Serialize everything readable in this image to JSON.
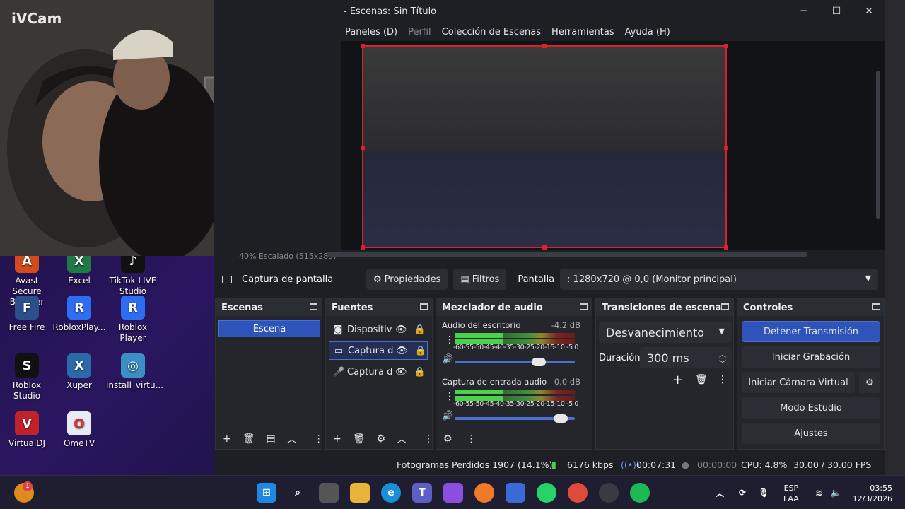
{
  "desktop": {
    "icons": [
      {
        "label": "Avast Secure Browser",
        "glyph": "A",
        "color": "#d44a1b"
      },
      {
        "label": "Excel",
        "glyph": "X",
        "color": "#1f7a45"
      },
      {
        "label": "TikTok LIVE Studio",
        "glyph": "♪",
        "color": "#111"
      },
      {
        "label": "Free Fire",
        "glyph": "F",
        "color": "#2a4f8a"
      },
      {
        "label": "RobloxPlay...",
        "glyph": "R",
        "color": "#2d6df2"
      },
      {
        "label": "Roblox Player",
        "glyph": "R",
        "color": "#2d6df2"
      },
      {
        "label": "Roblox Studio",
        "glyph": "S",
        "color": "#111"
      },
      {
        "label": "Xuper",
        "glyph": "X",
        "color": "#2a6aa8"
      },
      {
        "label": "install_virtu...",
        "glyph": "◎",
        "color": "#3a8fc4"
      },
      {
        "label": "VirtualDJ",
        "glyph": "V",
        "color": "#c0242a"
      },
      {
        "label": "OmeTV",
        "glyph": "O",
        "color": "#e7ecf2"
      }
    ]
  },
  "cam": {
    "brand": "iVCam"
  },
  "obs": {
    "title": "- Escenas: Sin Título",
    "menu": [
      "Paneles (D)",
      "Perfil",
      "Colección de Escenas",
      "Herramientas",
      "Ayuda (H)"
    ],
    "preview_status": "40%   Escalado (515x289)",
    "source_toolbar": {
      "source_name": "Captura de pantalla",
      "properties": "Propiedades",
      "filters": "Filtros",
      "display_label": "Pantalla",
      "display_value": ": 1280x720 @ 0,0 (Monitor principal)"
    },
    "scenes": {
      "title": "Escenas",
      "items": [
        "Escena"
      ]
    },
    "sources": {
      "title": "Fuentes",
      "items": [
        {
          "label": "Dispositiv",
          "icon": "camera-icon"
        },
        {
          "label": "Captura d",
          "icon": "monitor-icon"
        },
        {
          "label": "Captura d",
          "icon": "microphone-icon"
        }
      ]
    },
    "mixer": {
      "title": "Mezclador de audio",
      "scale": "-60-55-50-45-40-35-30-25-20-15-10 -5  0",
      "channels": [
        {
          "name": "Audio del escritorio",
          "db": "-4.2 dB",
          "volume": 0.7
        },
        {
          "name": "Captura de entrada audio",
          "db": "0.0 dB",
          "volume": 0.88
        }
      ]
    },
    "transitions": {
      "title": "Transiciones de escena",
      "selected": "Desvanecimiento",
      "duration_label": "Duración",
      "duration_value": "300 ms"
    },
    "controls": {
      "title": "Controles",
      "stop_stream": "Detener Transmisión",
      "start_recording": "Iniciar Grabación",
      "start_virtual_cam": "Iniciar Cámara Virtual",
      "studio_mode": "Modo Estudio",
      "settings": "Ajustes"
    },
    "status": {
      "dropped": "Fotogramas Perdidos 1907 (14.1%)",
      "bitrate": "6176 kbps",
      "stream_time": "00:07:31",
      "rec_time": "00:00:00",
      "cpu": "CPU: 4.8%",
      "fps": "30.00 / 30.00 FPS"
    }
  },
  "taskbar": {
    "notification_count": "1",
    "lang": "ESP",
    "layout": "LAA",
    "time": "03:55",
    "date": "12/3/2026"
  }
}
